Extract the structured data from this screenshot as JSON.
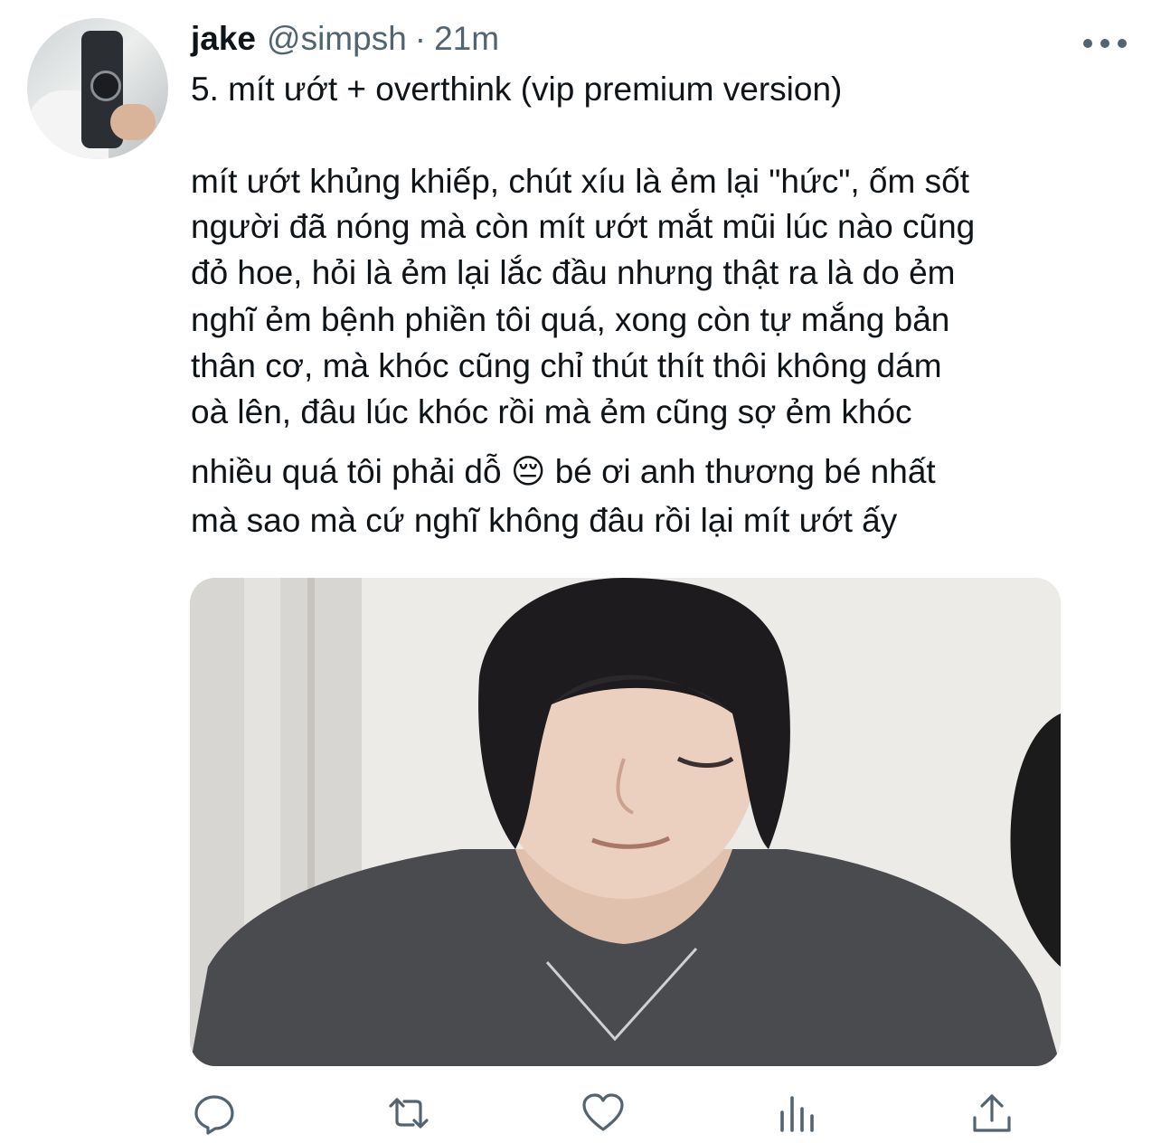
{
  "tweet": {
    "author_name": "jake",
    "author_handle": "@simpsh",
    "separator": "·",
    "time": "21m",
    "lines": [
      "5. mít ướt + overthink (vip premium version)",
      "mít ướt khủng khiếp, chút xíu là ẻm lại \"hức\", ốm sốt",
      "người đã nóng mà còn mít ướt mắt mũi lúc nào cũng",
      "đỏ hoe, hỏi là ẻm lại lắc đầu nhưng thật ra là do ẻm",
      "nghĩ ẻm bệnh phiền tôi quá, xong còn tự mắng bản",
      "thân cơ, mà khóc cũng chỉ thút thít thôi không dám",
      "oà lên, đâu lúc khóc rồi mà ẻm cũng sợ ẻm khóc",
      "nhiều quá tôi phải dỗ 😔  bé ơi anh thương bé nhất",
      "mà sao mà cứ nghĩ không đâu rồi lại mít ướt ấy"
    ]
  },
  "icons": {
    "more": "more-icon",
    "reply": "reply-icon",
    "retweet": "retweet-icon",
    "like": "like-icon",
    "analytics": "analytics-icon",
    "share": "share-icon"
  },
  "colors": {
    "text": "#0f1419",
    "secondary": "#536471",
    "icon_accent": "#1d9bf0"
  }
}
